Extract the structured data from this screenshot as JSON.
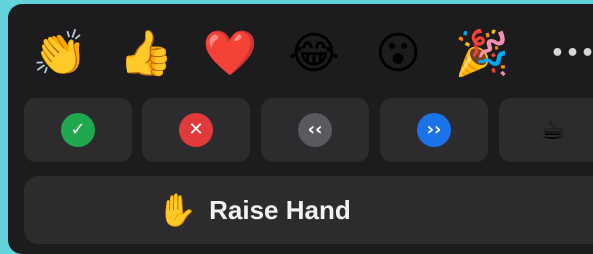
{
  "reactions": {
    "emojis": [
      {
        "name": "clapping-hands-icon",
        "glyph": "👏"
      },
      {
        "name": "thumbs-up-icon",
        "glyph": "👍"
      },
      {
        "name": "heart-icon",
        "glyph": "❤️"
      },
      {
        "name": "tears-of-joy-icon",
        "glyph": "😂"
      },
      {
        "name": "surprised-face-icon",
        "glyph": "😮"
      },
      {
        "name": "party-popper-icon",
        "glyph": "🎉"
      }
    ],
    "more_glyph": "•••"
  },
  "actions": [
    {
      "name": "yes",
      "glyph": "✓",
      "color": "#1fa84d"
    },
    {
      "name": "no",
      "glyph": "✕",
      "color": "#e03a3a"
    },
    {
      "name": "go-slower",
      "glyph": "‹‹",
      "color": "#5a5a5e"
    },
    {
      "name": "go-faster",
      "glyph": "››",
      "color": "#1a73e8"
    },
    {
      "name": "coffee-break",
      "glyph": "☕",
      "color": ""
    }
  ],
  "raise_hand": {
    "icon_glyph": "✋",
    "label": "Raise Hand"
  },
  "colors": {
    "background": "#62d3da",
    "panel": "#1c1c1e",
    "button": "#2c2c2e"
  }
}
